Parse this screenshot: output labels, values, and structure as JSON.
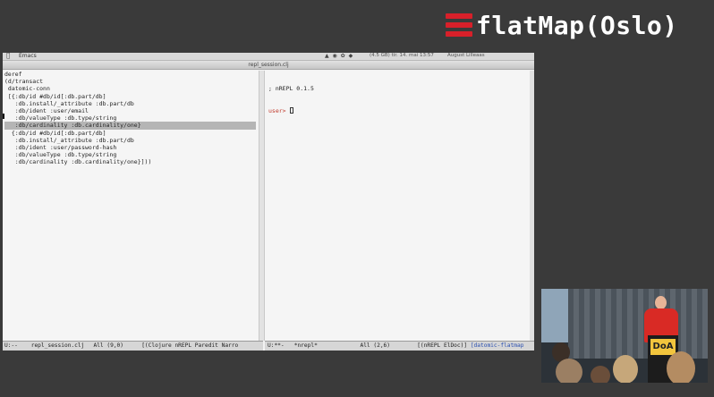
{
  "branding": {
    "title": "flatMap(Oslo)",
    "accent": "#d8202a"
  },
  "menubar": {
    "app": "Emacs",
    "status_icons": "▲ ◉ ✿ ◆",
    "status": "(4.5 GB)  tir. 14. mai  13:57",
    "user": "August Lilleaas"
  },
  "window": {
    "title": "repl_session.clj"
  },
  "editor_left": {
    "lines": [
      {
        "text": "deref",
        "highlight": false
      },
      {
        "text": "(d/transact",
        "highlight": false
      },
      {
        "text": " datomic-conn",
        "highlight": false
      },
      {
        "text": " [{:db/id #db/id[:db.part/db]",
        "highlight": false
      },
      {
        "text": "   :db.install/_attribute :db.part/db",
        "highlight": false
      },
      {
        "text": "   :db/ident :user/email",
        "highlight": false
      },
      {
        "text": "   :db/valueType :db.type/string",
        "highlight": false
      },
      {
        "text": "   :db/cardinality :db.cardinality/one}",
        "highlight": true
      },
      {
        "text": "",
        "highlight": false
      },
      {
        "text": "  {:db/id #db/id[:db.part/db]",
        "highlight": false
      },
      {
        "text": "   :db.install/_attribute :db.part/db",
        "highlight": false
      },
      {
        "text": "   :db/ident :user/password-hash",
        "highlight": false
      },
      {
        "text": "   :db/valueType :db.type/string",
        "highlight": false
      },
      {
        "text": "   :db/cardinality :db.cardinality/one}]))",
        "highlight": false
      }
    ],
    "mode_line": {
      "flags": "U:--",
      "buffer": "repl_session.clj",
      "position": "All (9,0)",
      "modes": "[(Clojure nREPL Paredit Narro"
    }
  },
  "repl_right": {
    "banner": "; nREPL 0.1.5",
    "prompt": "user>",
    "mode_line": {
      "flags": "U:**-",
      "buffer": "*nrepl*",
      "position": "All (2,6)",
      "modes": "[(nREPL ElDoc)]",
      "extra": "[datomic-flatmap"
    }
  },
  "colors": {
    "keyword": "#3a8ea0",
    "highlight": "#b5b5b5",
    "speaker_shirt": "#d92a25"
  },
  "video": {
    "podium_label": "DoA"
  }
}
